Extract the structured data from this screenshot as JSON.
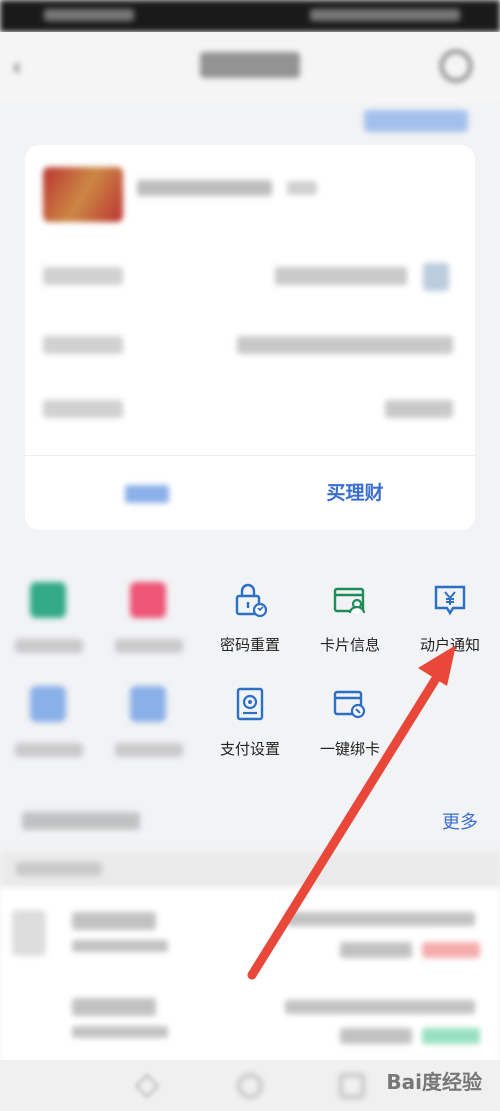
{
  "grid": {
    "items": [
      {
        "label": "密码重置",
        "icon": "lock-reset-icon"
      },
      {
        "label": "卡片信息",
        "icon": "card-info-icon"
      },
      {
        "label": "动户通知",
        "icon": "yen-notify-icon"
      },
      {
        "label": "支付设置",
        "icon": "payment-settings-icon"
      },
      {
        "label": "一键绑卡",
        "icon": "bind-card-icon"
      }
    ]
  },
  "card": {
    "buy_label": "买理财"
  },
  "transactions": {
    "more_label": "更多"
  },
  "watermark": {
    "text": "Bai度经验"
  },
  "colors": {
    "accent": "#3a6fd0",
    "icon_blue": "#2c6fc4",
    "icon_green": "#1f8a5a",
    "arrow": "#e8473a"
  }
}
